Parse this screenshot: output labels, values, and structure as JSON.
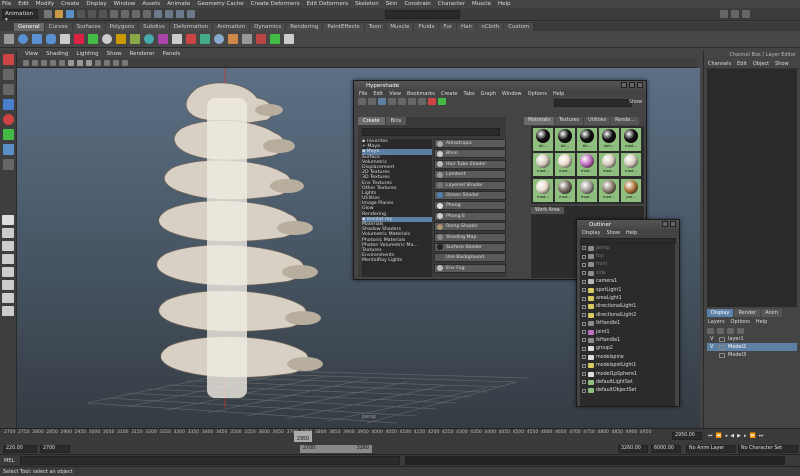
{
  "menubar": [
    "File",
    "Edit",
    "Modify",
    "Create",
    "Display",
    "Window",
    "Assets",
    "Animate",
    "Geometry Cache",
    "Create Deformers",
    "Edit Deformers",
    "Skeleton",
    "Skin",
    "Constrain",
    "Character",
    "Muscle",
    "Help"
  ],
  "statusline": {
    "mode": "Animation"
  },
  "shelf": {
    "tabs": [
      "General",
      "Curves",
      "Surfaces",
      "Polygons",
      "Subdivs",
      "Deformation",
      "Animation",
      "Dynamics",
      "Rendering",
      "PaintEffects",
      "Toon",
      "Muscle",
      "Fluids",
      "Fur",
      "Hair",
      "nCloth",
      "Custom"
    ],
    "active_tab": "General"
  },
  "viewport": {
    "menu": [
      "View",
      "Shading",
      "Lighting",
      "Show",
      "Renderer",
      "Panels"
    ],
    "camera_label": "persp"
  },
  "hypershade": {
    "title": "Hypershade",
    "menu": [
      "File",
      "Edit",
      "View",
      "Bookmarks",
      "Create",
      "Tabs",
      "Graph",
      "Window",
      "Options",
      "Help"
    ],
    "show_label": "Show",
    "left_tabs": [
      "Create",
      "Bins"
    ],
    "tree": [
      {
        "label": "▪ Favorites",
        "sel": false
      },
      {
        "label": "  + Maya",
        "sel": false
      },
      {
        "label": "▪ Maya",
        "sel": true
      },
      {
        "label": "   Surface",
        "sel": false
      },
      {
        "label": "   Volumetric",
        "sel": false
      },
      {
        "label": "   Displacement",
        "sel": false
      },
      {
        "label": "   2D Textures",
        "sel": false
      },
      {
        "label": "   3D Textures",
        "sel": false
      },
      {
        "label": "   Env Textures",
        "sel": false
      },
      {
        "label": "   Other Textures",
        "sel": false
      },
      {
        "label": "   Lights",
        "sel": false
      },
      {
        "label": "   Utilities",
        "sel": false
      },
      {
        "label": "   Image Planes",
        "sel": false
      },
      {
        "label": "   Glow",
        "sel": false
      },
      {
        "label": "   Rendering",
        "sel": false
      },
      {
        "label": "▪ mental ray",
        "sel": true
      },
      {
        "label": "   Materials",
        "sel": false
      },
      {
        "label": "   Shadow Shaders",
        "sel": false
      },
      {
        "label": "   Volumetric Materials",
        "sel": false
      },
      {
        "label": "   Photonic Materials",
        "sel": false
      },
      {
        "label": "   Photon Volumetric Ma…",
        "sel": false
      },
      {
        "label": "   Textures",
        "sel": false
      },
      {
        "label": "   Environments",
        "sel": false
      },
      {
        "label": "   MentalRay Lights",
        "sel": false
      }
    ],
    "nodes": [
      {
        "label": "Anisotropic",
        "color": "#aaaaaa"
      },
      {
        "label": "Blinn",
        "color": "#cccccc"
      },
      {
        "label": "Hair Tube Shader",
        "color": "#bbbbbb"
      },
      {
        "label": "Lambert",
        "color": "#999999"
      },
      {
        "label": "Layered Shader",
        "color": "#777777"
      },
      {
        "label": "Ocean Shader",
        "color": "#4a7fb0"
      },
      {
        "label": "Phong",
        "color": "#dddddd"
      },
      {
        "label": "Phong E",
        "color": "#cfcfcf"
      },
      {
        "label": "Ramp Shader",
        "color": "#a89070"
      },
      {
        "label": "Shading Map",
        "color": "#888888"
      },
      {
        "label": "Surface Shader",
        "color": "#222222"
      },
      {
        "label": "Use Background",
        "color": "#555555"
      },
      {
        "label": "Env Fog",
        "color": "#bbbbbb"
      }
    ],
    "right_tabs": [
      "Materials",
      "Textures",
      "Utilities",
      "Rende…"
    ],
    "swatches": [
      {
        "label": "bli...",
        "color": "#101010"
      },
      {
        "label": "bli...",
        "color": "#101010"
      },
      {
        "label": "bli...",
        "color": "#101010"
      },
      {
        "label": "lam...",
        "color": "#101010"
      },
      {
        "label": "mod...",
        "color": "#101010"
      },
      {
        "label": "mod...",
        "color": "#d8d0c0"
      },
      {
        "label": "mod...",
        "color": "#e7dccb"
      },
      {
        "label": "mod...",
        "color": "#c070c0"
      },
      {
        "label": "mod...",
        "color": "#d8d0c0"
      },
      {
        "label": "mod...",
        "color": "#d8d0c0"
      },
      {
        "label": "mod...",
        "color": "#e7dccb"
      },
      {
        "label": "mod...",
        "color": "#7a6f64"
      },
      {
        "label": "mod...",
        "color": "#a4a09a"
      },
      {
        "label": "mod...",
        "color": "#8f8273"
      },
      {
        "label": "pai...",
        "color": "#b07a42"
      }
    ],
    "work_area_label": "Work Area"
  },
  "outliner": {
    "title": "Outliner",
    "menu": [
      "Display",
      "Show",
      "Help"
    ],
    "items": [
      {
        "label": "persp",
        "dim": true,
        "icon": "#8a8a8a"
      },
      {
        "label": "top",
        "dim": true,
        "icon": "#8a8a8a"
      },
      {
        "label": "front",
        "dim": true,
        "icon": "#8a8a8a"
      },
      {
        "label": "side",
        "dim": true,
        "icon": "#8a8a8a"
      },
      {
        "label": "camera1",
        "dim": false,
        "icon": "#b9b9b9"
      },
      {
        "label": "spotLight1",
        "dim": false,
        "icon": "#d8c860"
      },
      {
        "label": "areaLight1",
        "dim": false,
        "icon": "#d8c860"
      },
      {
        "label": "directionalLight1",
        "dim": false,
        "icon": "#d8c860"
      },
      {
        "label": "directionalLight2",
        "dim": false,
        "icon": "#d8c860"
      },
      {
        "label": "ikHandle1",
        "dim": false,
        "icon": "#8a8a8a"
      },
      {
        "label": "joint1",
        "dim": false,
        "icon": "#c070c0"
      },
      {
        "label": "ikHandle1",
        "dim": false,
        "icon": "#8a8a8a"
      },
      {
        "label": "group2",
        "dim": false,
        "icon": "#dddddd"
      },
      {
        "label": "modelspine",
        "dim": false,
        "icon": "#dddddd"
      },
      {
        "label": "modelspotLight1",
        "dim": false,
        "icon": "#d8c860"
      },
      {
        "label": "model1pSphere1",
        "dim": false,
        "icon": "#dddddd"
      },
      {
        "label": "defaultLightSet",
        "dim": false,
        "icon": "#8fbf7f"
      },
      {
        "label": "defaultObjectSet",
        "dim": false,
        "icon": "#8fbf7f"
      }
    ]
  },
  "channelbox": {
    "title": "Channel Box / Layer Editor",
    "menu": [
      "Channels",
      "Edit",
      "Object",
      "Show"
    ]
  },
  "layers": {
    "tabs": [
      "Display",
      "Render",
      "Anim"
    ],
    "menu": [
      "Layers",
      "Options",
      "Help"
    ],
    "items": [
      {
        "vis": "V",
        "label": "layer1",
        "sel": false
      },
      {
        "vis": "V",
        "label": "Model2",
        "sel": true
      },
      {
        "vis": "",
        "label": "Model3",
        "sel": false
      }
    ]
  },
  "timeline": {
    "ticks": [
      "2700",
      "2750",
      "2800",
      "2850",
      "2900",
      "2950",
      "3000",
      "3050",
      "3100",
      "3150",
      "3200",
      "3250",
      "3300",
      "3350",
      "3400",
      "3450",
      "3500",
      "3550",
      "3600",
      "3650",
      "3700",
      "3750",
      "3800",
      "3850",
      "3900",
      "3950",
      "4000",
      "4050",
      "4100",
      "4150",
      "4200",
      "4250",
      "4300",
      "4350",
      "4400",
      "4450",
      "4500",
      "4550",
      "4600",
      "4650",
      "4700",
      "4750",
      "4800",
      "4850",
      "4900",
      "4950"
    ],
    "current_frame": "2950",
    "current_field": "2950.00"
  },
  "range": {
    "start": "220.00",
    "inner_start": "2700",
    "range_start_label": "2700",
    "range_end_label": "3260",
    "end": "3260.00",
    "total": "6000.00",
    "anim_layer": "No Anim Layer",
    "char_set": "No Character Set"
  },
  "commandline": {
    "lang": "MEL"
  },
  "helpline": {
    "text": "Select Tool: select an object"
  }
}
